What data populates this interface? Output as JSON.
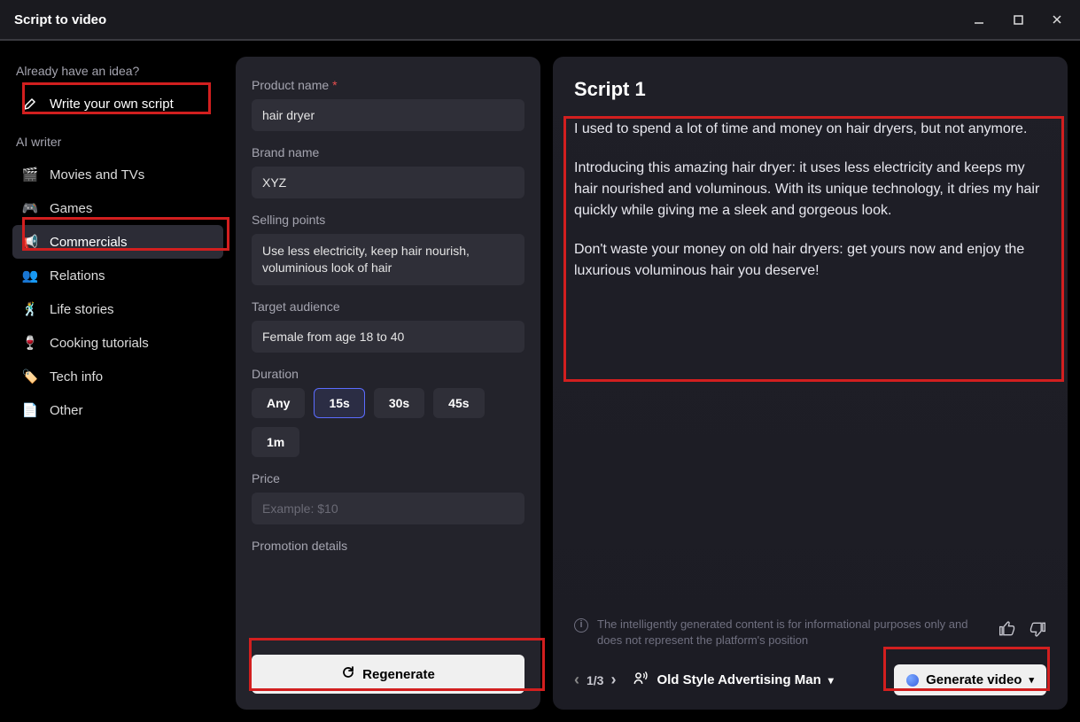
{
  "window": {
    "title": "Script to video"
  },
  "sidebar": {
    "prompt_label": "Already have an idea?",
    "write_own": "Write your own script",
    "ai_label": "AI writer",
    "items": [
      {
        "label": "Movies and TVs",
        "icon": "🎬",
        "color": "#6b5cff"
      },
      {
        "label": "Games",
        "icon": "🎮",
        "color": "#b44bff"
      },
      {
        "label": "Commercials",
        "icon": "📢",
        "color": "#2a8cff",
        "active": true
      },
      {
        "label": "Relations",
        "icon": "👥",
        "color": "#2a8cff"
      },
      {
        "label": "Life stories",
        "icon": "🕺",
        "color": "#20c6b6"
      },
      {
        "label": "Cooking tutorials",
        "icon": "🍷",
        "color": "#b64bff"
      },
      {
        "label": "Tech info",
        "icon": "🏷️",
        "color": "#20a6ff"
      },
      {
        "label": "Other",
        "icon": "📄",
        "color": "#8a8a95"
      }
    ]
  },
  "form": {
    "product_name_label": "Product name",
    "product_name": "hair dryer",
    "brand_label": "Brand name",
    "brand": "XYZ",
    "selling_label": "Selling points",
    "selling": "Use less electricity, keep hair nourish, voluminious look of hair",
    "audience_label": "Target audience",
    "audience": "Female from age 18 to 40",
    "duration_label": "Duration",
    "durations": [
      "Any",
      "15s",
      "30s",
      "45s",
      "1m"
    ],
    "duration_selected": "15s",
    "price_label": "Price",
    "price_placeholder": "Example: $10",
    "promo_label": "Promotion details",
    "regenerate": "Regenerate"
  },
  "script": {
    "heading": "Script 1",
    "paragraphs": [
      "I used to spend a lot of time and money on hair dryers, but not anymore.",
      "Introducing this amazing hair dryer: it uses less electricity and keeps my hair nourished and voluminous. With its unique technology, it dries my hair quickly while giving me a sleek and gorgeous look.",
      "Don't waste your money on old hair dryers: get yours now and enjoy the luxurious voluminous hair you deserve!"
    ],
    "disclaimer": "The intelligently generated content is for informational purposes only and does not represent the platform's position",
    "pager": "1/3",
    "voice": "Old Style Advertising Man",
    "generate": "Generate video"
  },
  "colors": {
    "accent": "#5b6cff",
    "highlight": "#d21f1f"
  }
}
